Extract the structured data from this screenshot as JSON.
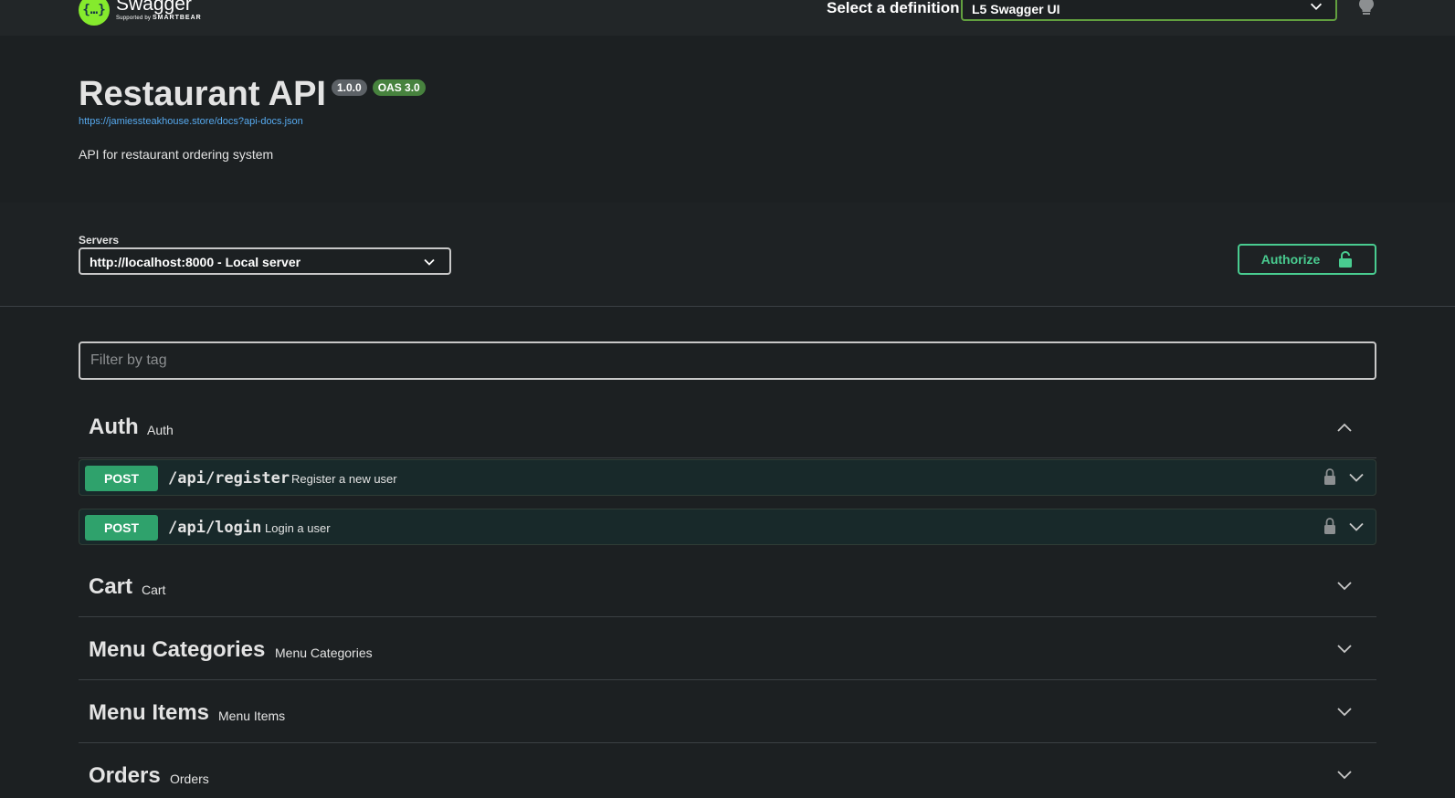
{
  "header": {
    "logo_word": "Swagger",
    "logo_sub_prefix": "Supported by",
    "logo_sub_brand": "SMARTBEAR",
    "definition_label": "Select a definition",
    "definition_value": "L5 Swagger UI"
  },
  "info": {
    "title": "Restaurant API",
    "version": "1.0.0",
    "oas": "OAS 3.0",
    "spec_url": "https://jamiessteakhouse.store/docs?api-docs.json",
    "description": "API for restaurant ordering system"
  },
  "servers": {
    "label": "Servers",
    "selected": "http://localhost:8000 - Local server"
  },
  "authorize": {
    "label": "Authorize"
  },
  "filter": {
    "placeholder": "Filter by tag"
  },
  "tags": [
    {
      "name": "Auth",
      "description": "Auth",
      "expanded": true
    },
    {
      "name": "Cart",
      "description": "Cart",
      "expanded": false
    },
    {
      "name": "Menu Categories",
      "description": "Menu Categories",
      "expanded": false
    },
    {
      "name": "Menu Items",
      "description": "Menu Items",
      "expanded": false
    },
    {
      "name": "Orders",
      "description": "Orders",
      "expanded": false
    }
  ],
  "operations": [
    {
      "method": "POST",
      "path": "/api/register",
      "summary": "Register a new user"
    },
    {
      "method": "POST",
      "path": "/api/login",
      "summary": "Login a user"
    }
  ],
  "colors": {
    "background": "#1c2022",
    "accent_green": "#49cc90",
    "post_method": "#2fa26c",
    "link": "#56a9ee"
  }
}
